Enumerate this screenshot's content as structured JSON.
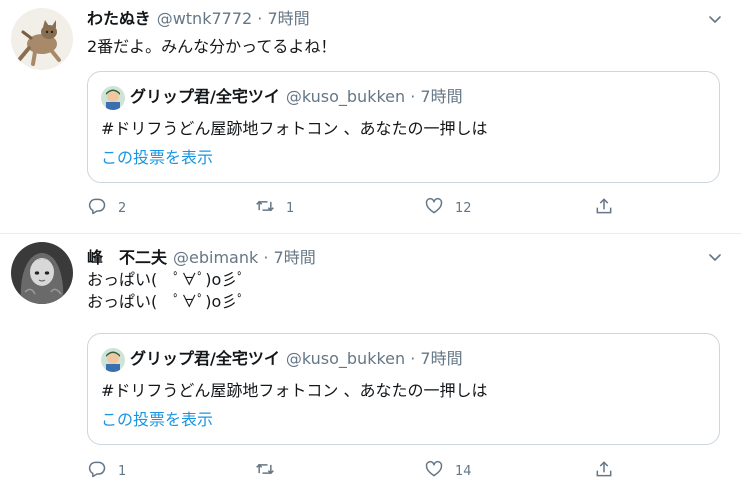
{
  "tweets": [
    {
      "name": "わたぬき",
      "handle": "@wtnk7772",
      "dot": "·",
      "time": "7時間",
      "text": "2番だよ。みんな分かってるよね！",
      "quote": {
        "name": "グリップ君/全宅ツイ",
        "handle": "@kuso_bukken",
        "dot": "·",
        "time": "7時間",
        "text": "#ドリフうどん屋跡地フォトコン 、あなたの一押しは",
        "link": "この投票を表示"
      },
      "actions": {
        "reply": "2",
        "retweet": "1",
        "like": "12",
        "share": ""
      }
    },
    {
      "name": "峰　不二夫",
      "handle": "@ebimank",
      "dot": "·",
      "time": "7時間",
      "text": "おっぱい(　ﾟ∀ﾟ)o彡ﾟ\nおっぱい(　ﾟ∀ﾟ)o彡ﾟ",
      "quote": {
        "name": "グリップ君/全宅ツイ",
        "handle": "@kuso_bukken",
        "dot": "·",
        "time": "7時間",
        "text": "#ドリフうどん屋跡地フォトコン 、あなたの一押しは",
        "link": "この投票を表示"
      },
      "actions": {
        "reply": "1",
        "retweet": "",
        "like": "14",
        "share": ""
      }
    }
  ],
  "icons": {
    "reply": "reply-icon",
    "retweet": "retweet-icon",
    "like": "like-icon",
    "share": "share-icon",
    "caret": "chevron-down-icon"
  },
  "colors": {
    "text": "#14171a",
    "secondary": "#657786",
    "link": "#1b95e0",
    "border": "#ccd6dd",
    "divider": "#e6ecf0"
  }
}
